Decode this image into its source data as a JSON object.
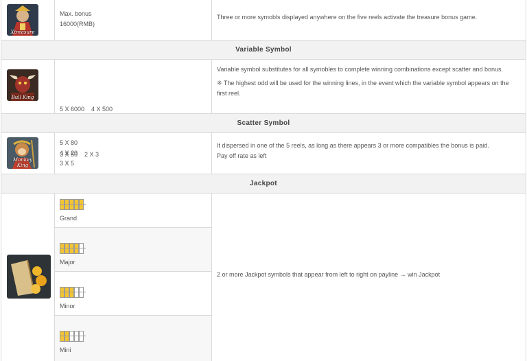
{
  "rows": {
    "treasure": {
      "icon_caption": "Xtreasure",
      "payout_line1": "Max. bonus",
      "payout_line2": "16000(RMB)",
      "description": "Three or more symobls displayed anywhere on the five reels activate the treasure bonus game."
    },
    "variable_header": "Variable Symbol",
    "variable": {
      "icon_caption": "Bull King",
      "payout_line1": "5 X 6000    4 X 500",
      "payout_line2": "3 X 50    2 X 3",
      "description_line1": "Variable symbol substitutes for all symobles to complete winning combinations except scatter and bonus.",
      "description_line2": "※ The highest odd will be used for the winning lines, in the event which the variable symbol appears on the first reel."
    },
    "scatter_header": "Scatter Symbol",
    "scatter": {
      "icon_caption": "Monkey King",
      "payout_line1": "5 X 80",
      "payout_line2": "4 X 20",
      "payout_line3": "3 X 5",
      "description_line1": "It dispersed in one of the 5 reels, as long as there appears 3 or more compatibles the bonus is paid.",
      "description_line2": "Pay off rate as left"
    },
    "jackpot_header": "Jackpot",
    "jackpot": {
      "levels": [
        {
          "label": "Grand",
          "lit": 5
        },
        {
          "label": "Major",
          "lit": 4
        },
        {
          "label": "Minor",
          "lit": 3
        },
        {
          "label": "Mini",
          "lit": 2
        }
      ],
      "description": "2 or more Jackpot symbols that appear from left to right on payline → win Jackpot"
    }
  },
  "colors": {
    "header_bg": "#f2f2f2",
    "border": "#d9d9d9",
    "reel_lit": "#f3c534"
  },
  "icons": [
    "treasure-symbol-icon",
    "bull-king-symbol-icon",
    "monkey-king-symbol-icon",
    "jackpot-symbol-icon"
  ]
}
